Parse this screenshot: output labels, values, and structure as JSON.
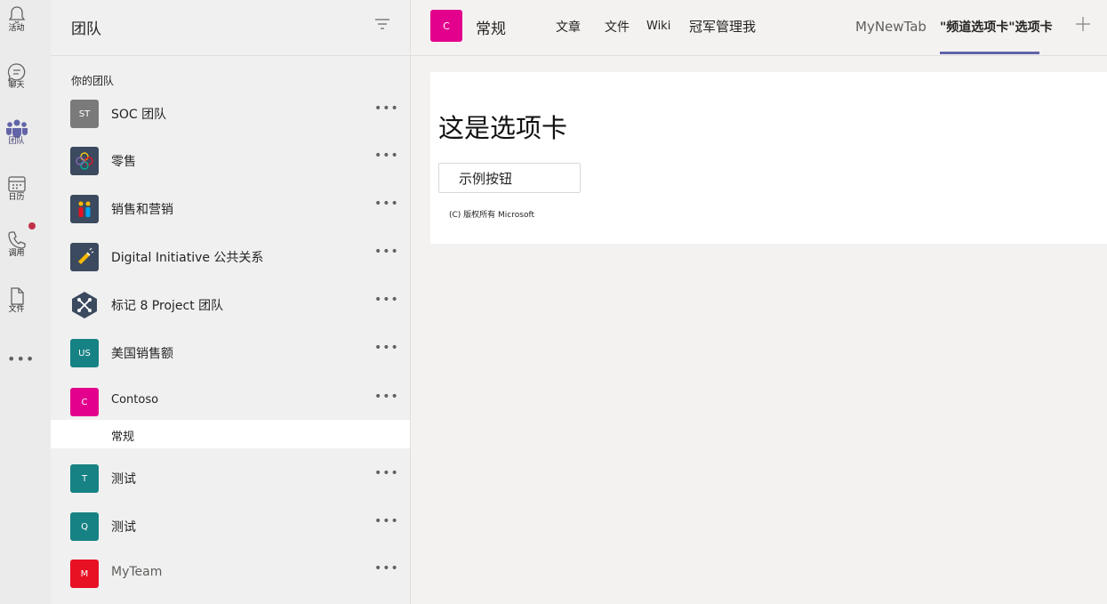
{
  "rail": {
    "items": [
      {
        "label": "活动",
        "icon": "bell-icon"
      },
      {
        "label": "聊天",
        "icon": "chat-icon"
      },
      {
        "label": "团队",
        "icon": "teams-icon"
      },
      {
        "label": "日历",
        "icon": "calendar-icon"
      },
      {
        "label": "调用",
        "icon": "phone-icon"
      },
      {
        "label": "文件",
        "icon": "file-icon"
      }
    ],
    "more": "•••"
  },
  "panel": {
    "title": "团队",
    "section_label": "你的团队",
    "teams": [
      {
        "initials": "ST",
        "name": "SOC 团队",
        "color": "#7a7a7a"
      },
      {
        "initials": "",
        "name": "零售",
        "color": "#3b4a5e"
      },
      {
        "initials": "",
        "name": "销售和营销",
        "color": "#3b4a5e"
      },
      {
        "initials": "",
        "name": "Digital Initiative 公共关系",
        "color": "#3b4a5e"
      },
      {
        "initials": "",
        "name": "标记 8 Project 团队",
        "color": "#3b4a5e"
      },
      {
        "initials": "US",
        "name": "美国销售额",
        "color": "#168284"
      },
      {
        "initials": "C",
        "name": "Contoso",
        "color": "#e3008c"
      },
      {
        "initials": "T",
        "name": "测试",
        "color": "#168284"
      },
      {
        "initials": "Q",
        "name": "测试",
        "color": "#168284"
      },
      {
        "initials": "M",
        "name": "MyTeam",
        "color": "#e81123"
      }
    ],
    "more_label": "•••",
    "selected_channel": "常规"
  },
  "topbar": {
    "channel_initial": "C",
    "channel_title": "常规",
    "tabs": [
      "文章",
      "文件",
      "Wiki",
      "冠军管理我",
      "MyNewTab",
      "\"频道选项卡\"选项卡"
    ],
    "active_tab": "\"频道选项卡\"选项卡"
  },
  "content": {
    "heading": "这是选项卡",
    "button_label": "示例按钮",
    "copyright": "(C) 版权所有 Microsoft"
  },
  "colors": {
    "accent": "#6264a7",
    "notification": "#c4314b"
  }
}
